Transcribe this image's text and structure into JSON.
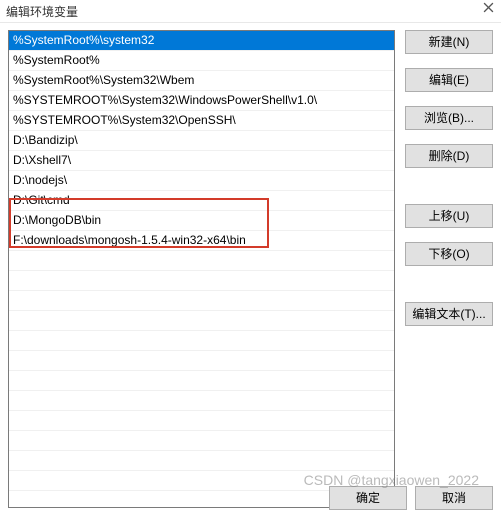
{
  "dialog": {
    "title": "编辑环境变量"
  },
  "list": {
    "items": [
      "%SystemRoot%\\system32",
      "%SystemRoot%",
      "%SystemRoot%\\System32\\Wbem",
      "%SYSTEMROOT%\\System32\\WindowsPowerShell\\v1.0\\",
      "%SYSTEMROOT%\\System32\\OpenSSH\\",
      "D:\\Bandizip\\",
      "D:\\Xshell7\\",
      "D:\\nodejs\\",
      "D:\\Git\\cmd",
      "D:\\MongoDB\\bin",
      "F:\\downloads\\mongosh-1.5.4-win32-x64\\bin"
    ],
    "selected_index": 0
  },
  "highlight": {
    "from_index": 9,
    "to_index": 10
  },
  "buttons": {
    "new": "新建(N)",
    "edit": "编辑(E)",
    "browse": "浏览(B)...",
    "delete": "删除(D)",
    "move_up": "上移(U)",
    "move_down": "下移(O)",
    "edit_text": "编辑文本(T)...",
    "ok": "确定",
    "cancel": "取消"
  },
  "watermark": "CSDN @tangxiaowen_2022"
}
